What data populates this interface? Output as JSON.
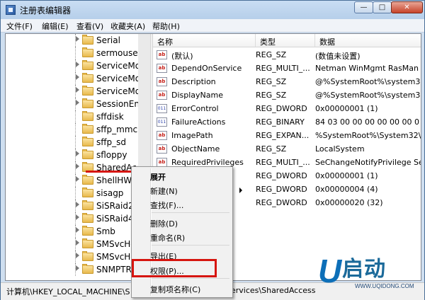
{
  "window": {
    "title": "注册表编辑器"
  },
  "title_buttons": {
    "minimize": "—",
    "maximize": "□",
    "close": "✕"
  },
  "menubar": {
    "items": [
      "文件(F)",
      "编辑(E)",
      "查看(V)",
      "收藏夹(A)",
      "帮助(H)"
    ]
  },
  "tree": {
    "items": [
      "Serial",
      "sermouse",
      "ServiceMod",
      "ServiceMod",
      "ServiceMod",
      "SessionEnv",
      "sffdisk",
      "sffp_mmc",
      "sffp_sd",
      "sfloppy",
      "SharedAccess",
      "ShellHWD",
      "sisagp",
      "SiSRaid2",
      "SiSRaid4",
      "Smb",
      "SMSvcHo",
      "SMSvcHo",
      "SNMPTR"
    ],
    "selected": "SharedAccess"
  },
  "list": {
    "columns": [
      "名称",
      "类型",
      "数据"
    ],
    "rows": [
      {
        "icon": "string-value-icon",
        "name": "(默认)",
        "type": "REG_SZ",
        "data": "(数值未设置)"
      },
      {
        "icon": "string-value-icon",
        "name": "DependOnService",
        "type": "REG_MULTI_...",
        "data": "Netman WinMgmt RasMan"
      },
      {
        "icon": "string-value-icon",
        "name": "Description",
        "type": "REG_SZ",
        "data": "@%SystemRoot%\\system32\\"
      },
      {
        "icon": "string-value-icon",
        "name": "DisplayName",
        "type": "REG_SZ",
        "data": "@%SystemRoot%\\system32\\"
      },
      {
        "icon": "binary-value-icon",
        "name": "ErrorControl",
        "type": "REG_DWORD",
        "data": "0x00000001 (1)"
      },
      {
        "icon": "binary-value-icon",
        "name": "FailureActions",
        "type": "REG_BINARY",
        "data": "84 03 00 00 00 00 00 00 0"
      },
      {
        "icon": "string-value-icon",
        "name": "ImagePath",
        "type": "REG_EXPAN...",
        "data": "%SystemRoot%\\System32\\sv"
      },
      {
        "icon": "string-value-icon",
        "name": "ObjectName",
        "type": "REG_SZ",
        "data": "LocalSystem"
      },
      {
        "icon": "string-value-icon",
        "name": "RequiredPrivileges",
        "type": "REG_MULTI_...",
        "data": "SeChangeNotifyPrivilege Se"
      },
      {
        "icon": "binary-value-icon",
        "name": "",
        "type": "REG_DWORD",
        "data": "0x00000001 (1)"
      },
      {
        "icon": "binary-value-icon",
        "name": "",
        "type": "REG_DWORD",
        "data": "0x00000004 (4)"
      },
      {
        "icon": "binary-value-icon",
        "name": "",
        "type": "REG_DWORD",
        "data": "0x00000020 (32)"
      }
    ]
  },
  "context_menu": {
    "expand": "展开",
    "new": "新建(N)",
    "find": "查找(F)...",
    "delete": "删除(D)",
    "rename": "重命名(R)",
    "export": "导出(E)",
    "permissions": "权限(P)...",
    "copy_key_name": "复制项名称(C)"
  },
  "statusbar": {
    "path_left": "计算机\\HKEY_LOCAL_MACHINE\\S",
    "path_right": "ervices\\SharedAccess"
  },
  "watermark": {
    "brand_letter": "U",
    "brand_text": "启动",
    "url": "WWW.UQIDONG.COM"
  },
  "colors": {
    "highlight_red": "#d6150f",
    "brand_blue": "#0d6fb8"
  }
}
